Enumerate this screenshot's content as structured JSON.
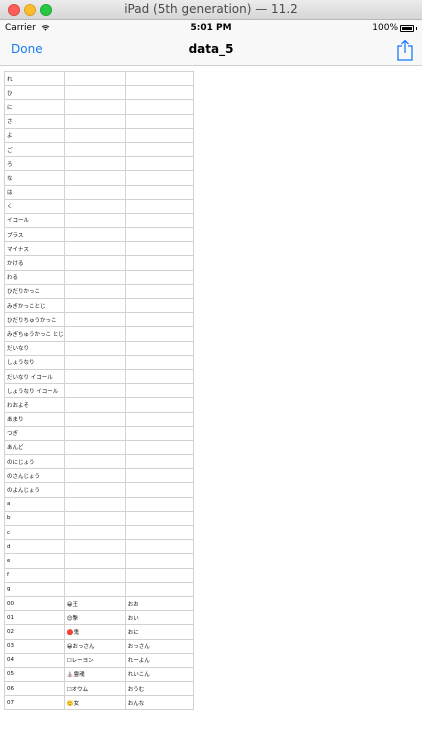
{
  "window": {
    "title": "iPad (5th generation) — 11.2"
  },
  "status_bar": {
    "carrier": "Carrier",
    "time": "5:01 PM",
    "battery": "100%"
  },
  "nav": {
    "done_label": "Done",
    "title": "data_5"
  },
  "table": {
    "rows": [
      [
        "れ",
        "",
        ""
      ],
      [
        "ひ",
        "",
        ""
      ],
      [
        "に",
        "",
        ""
      ],
      [
        "さ",
        "",
        ""
      ],
      [
        "よ",
        "",
        ""
      ],
      [
        "ご",
        "",
        ""
      ],
      [
        "ろ",
        "",
        ""
      ],
      [
        "な",
        "",
        ""
      ],
      [
        "は",
        "",
        ""
      ],
      [
        "く",
        "",
        ""
      ],
      [
        "イコール",
        "",
        ""
      ],
      [
        "プラス",
        "",
        ""
      ],
      [
        "マイナス",
        "",
        ""
      ],
      [
        "かける",
        "",
        ""
      ],
      [
        "わる",
        "",
        ""
      ],
      [
        "ひだりかっこ",
        "",
        ""
      ],
      [
        "みぎかっことじ",
        "",
        ""
      ],
      [
        "ひだりちゅうかっこ",
        "",
        ""
      ],
      [
        "みぎちゅうかっこ とじ",
        "",
        ""
      ],
      [
        "だいなり",
        "",
        ""
      ],
      [
        "しょうなり",
        "",
        ""
      ],
      [
        "だいなり イコール",
        "",
        ""
      ],
      [
        "しょうなり イコール",
        "",
        ""
      ],
      [
        "わおよそ",
        "",
        ""
      ],
      [
        "あまり",
        "",
        ""
      ],
      [
        "つぎ",
        "",
        ""
      ],
      [
        "あんど",
        "",
        ""
      ],
      [
        "のにじょう",
        "",
        ""
      ],
      [
        "のさんじょう",
        "",
        ""
      ],
      [
        "のよんじょう",
        "",
        ""
      ],
      [
        "a",
        "",
        ""
      ],
      [
        "b",
        "",
        ""
      ],
      [
        "c",
        "",
        ""
      ],
      [
        "d",
        "",
        ""
      ],
      [
        "e",
        "",
        ""
      ],
      [
        "f",
        "",
        ""
      ],
      [
        "g",
        "",
        ""
      ],
      [
        "00",
        "😀王",
        "おお"
      ],
      [
        "01",
        "😊撃",
        "おい"
      ],
      [
        "02",
        "🔴鬼",
        "おに"
      ],
      [
        "03",
        "😀おっさん",
        "おっさん"
      ],
      [
        "04",
        "☐レーヨン",
        "れーよん"
      ],
      [
        "05",
        "⛪霊魂",
        "れいこん"
      ],
      [
        "06",
        "☐オウム",
        "おうむ"
      ],
      [
        "07",
        "🙂女",
        "おんな"
      ]
    ]
  }
}
